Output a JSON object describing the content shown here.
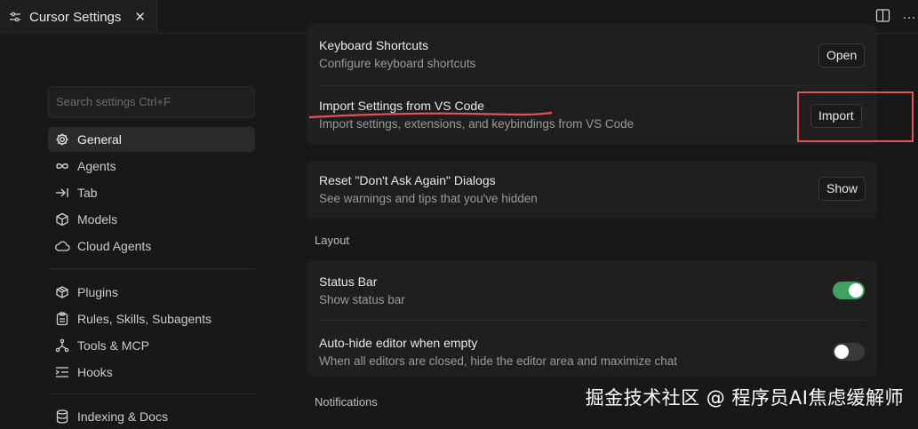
{
  "tab": {
    "title": "Cursor Settings",
    "close": "✕",
    "icon": "settings-sliders-icon"
  },
  "search": {
    "placeholder": "Search settings Ctrl+F"
  },
  "sidebar": {
    "group1": [
      {
        "label": "General",
        "icon": "gear-icon",
        "active": true
      },
      {
        "label": "Agents",
        "icon": "infinity-icon"
      },
      {
        "label": "Tab",
        "icon": "tab-arrow-icon"
      },
      {
        "label": "Models",
        "icon": "cube-icon"
      },
      {
        "label": "Cloud Agents",
        "icon": "cloud-icon"
      }
    ],
    "group2": [
      {
        "label": "Plugins",
        "icon": "plugin-box-icon"
      },
      {
        "label": "Rules, Skills, Subagents",
        "icon": "clipboard-icon"
      },
      {
        "label": "Tools & MCP",
        "icon": "network-icon"
      },
      {
        "label": "Hooks",
        "icon": "hooks-list-icon"
      }
    ],
    "group3": [
      {
        "label": "Indexing & Docs",
        "icon": "database-icon"
      }
    ]
  },
  "general": {
    "keyboard": {
      "title": "Keyboard Shortcuts",
      "desc": "Configure keyboard shortcuts",
      "button": "Open"
    },
    "import": {
      "title": "Import Settings from VS Code",
      "desc": "Import settings, extensions, and keybindings from VS Code",
      "button": "Import"
    },
    "reset": {
      "title": "Reset \"Don't Ask Again\" Dialogs",
      "desc": "See warnings and tips that you've hidden",
      "button": "Show"
    }
  },
  "layout": {
    "label": "Layout",
    "status_bar": {
      "title": "Status Bar",
      "desc": "Show status bar",
      "enabled": true
    },
    "auto_hide": {
      "title": "Auto-hide editor when empty",
      "desc": "When all editors are closed, hide the editor area and maximize chat",
      "enabled": false
    }
  },
  "notifications": {
    "label": "Notifications"
  },
  "watermark": "掘金技术社区 @ 程序员AI焦虑缓解师",
  "colors": {
    "toggle_on": "#3ea360",
    "annotation": "#e25454"
  }
}
